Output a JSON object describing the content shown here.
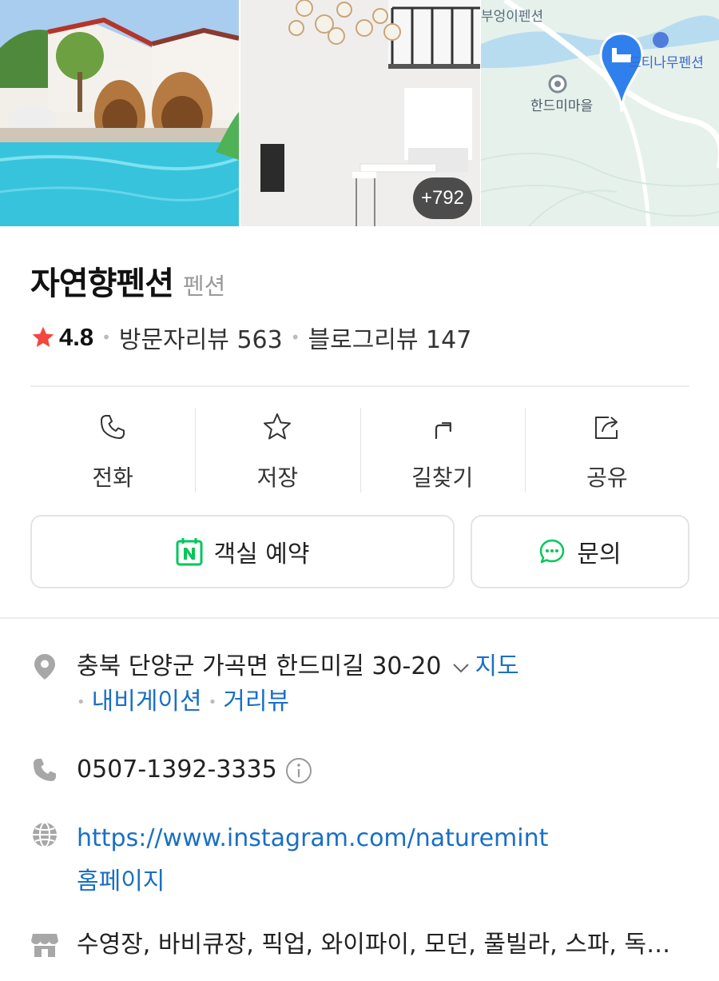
{
  "gallery": {
    "more_count": "+792",
    "map_labels": [
      "부엉이펜션",
      "드티나무펜션",
      "한드미마을"
    ]
  },
  "place": {
    "name": "자연향펜션",
    "category": "펜션",
    "rating": "4.8",
    "visitor_reviews": "방문자리뷰 563",
    "blog_reviews": "블로그리뷰 147"
  },
  "actions": {
    "call": "전화",
    "save": "저장",
    "directions": "길찾기",
    "share": "공유"
  },
  "booking": {
    "reserve": "객실 예약",
    "inquiry": "문의"
  },
  "info": {
    "address": "충북 단양군 가곡면 한드미길 30-20",
    "map_link": "지도",
    "navigation": "내비게이션",
    "street_view": "거리뷰",
    "phone": "0507-1392-3335",
    "website": "https://www.instagram.com/naturemint",
    "homepage_label": "홈페이지",
    "amenities": "수영장, 바비큐장, 픽업, 와이파이, 모던, 풀빌라, 스파, 독…"
  },
  "colors": {
    "link": "#1a6fc4",
    "star": "#f2473f",
    "naver_green": "#03c75a",
    "map_pin": "#2f80ed"
  }
}
